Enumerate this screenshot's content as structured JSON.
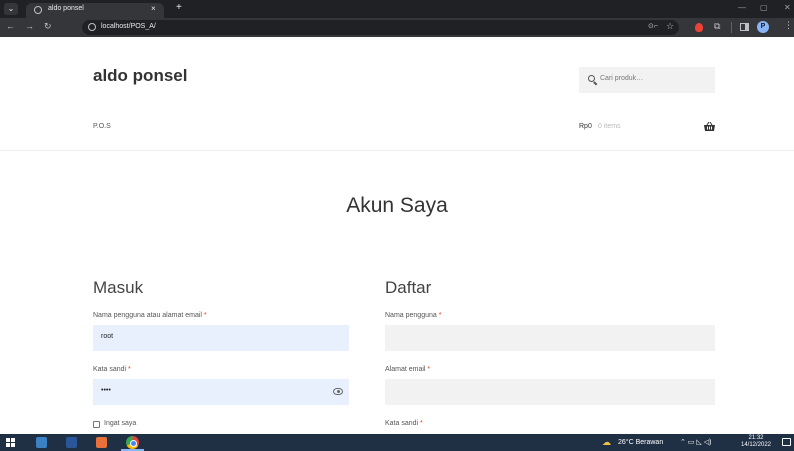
{
  "browser": {
    "tab_title": "aldo ponsel",
    "tab_close": "×",
    "new_tab": "+",
    "url": "localhost/POS_A/",
    "profile_initial": "P"
  },
  "site": {
    "title": "aldo ponsel",
    "search_placeholder": "Cari produk…",
    "nav_link": "P.O.S",
    "cart_total": "Rp0",
    "cart_count": "0 items"
  },
  "page": {
    "heading": "Akun Saya"
  },
  "login": {
    "title": "Masuk",
    "username_label": "Nama pengguna atau alamat email",
    "username_value": "root",
    "password_label": "Kata sandi",
    "password_value": "••••",
    "remember_label": "Ingat saya",
    "required_mark": "*"
  },
  "register": {
    "title": "Daftar",
    "username_label": "Nama pengguna",
    "email_label": "Alamat email",
    "password_label": "Kata sandi",
    "required_mark": "*"
  },
  "taskbar": {
    "weather": "26°C  Berawan",
    "clock_time": "21:32",
    "clock_date": "14/12/2022"
  },
  "icons": [
    "search-icon",
    "basket-icon",
    "eye-icon",
    "windows-start-icon",
    "chrome-icon"
  ],
  "colors": {
    "required": "#e2401c",
    "autofill": "#e8f0fe",
    "field_bg": "#f2f2f2"
  }
}
